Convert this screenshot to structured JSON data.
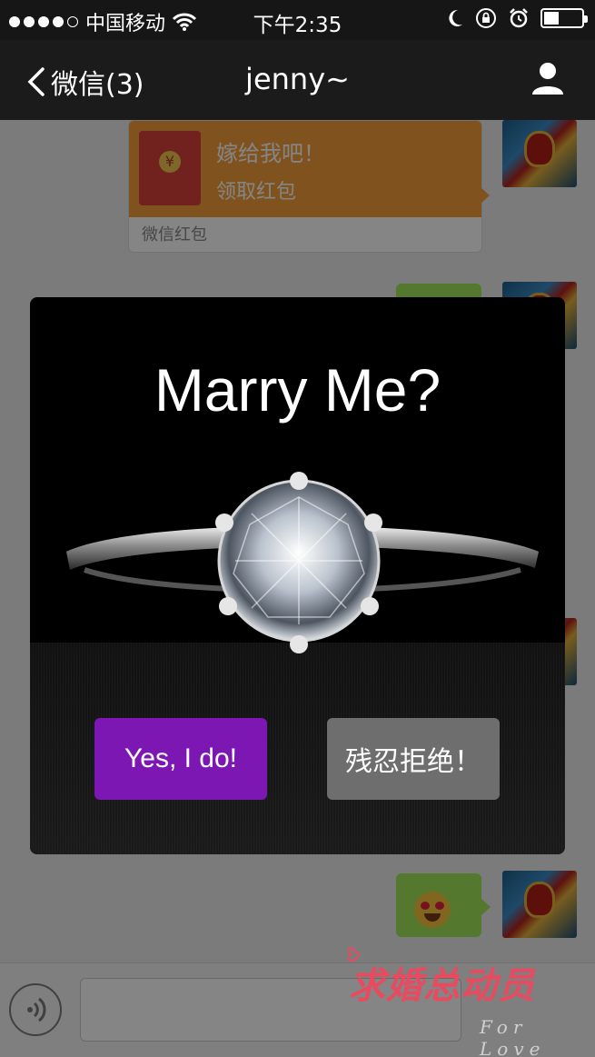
{
  "status_bar": {
    "carrier": "中国移动",
    "time": "下午2:35",
    "battery_level": 0.4
  },
  "nav": {
    "back_label": "微信(3)",
    "title": "jenny~"
  },
  "chat": {
    "red_packet": {
      "title": "嫁给我吧！",
      "action": "领取红包",
      "footer": "微信红包",
      "coin_symbol": "¥"
    }
  },
  "modal": {
    "title": "Marry Me?",
    "accept_label": "Yes, I do!",
    "reject_label": "残忍拒绝！"
  },
  "watermark": {
    "text": "求婚总动员",
    "sub": "For Love"
  },
  "colors": {
    "accept": "#7d17b4",
    "reject": "#6e6e6e",
    "red_packet": "#f6a03a",
    "bubble": "#9fe658"
  }
}
